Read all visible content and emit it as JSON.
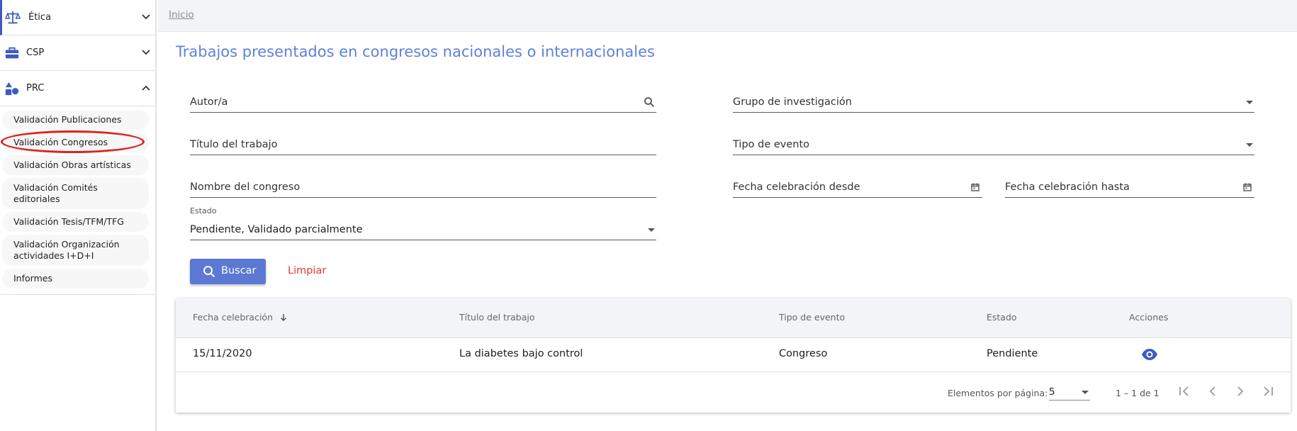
{
  "sidebar": {
    "groups": [
      {
        "label": "Ética",
        "icon": "scales-icon",
        "expanded": false
      },
      {
        "label": "CSP",
        "icon": "briefcase-icon",
        "expanded": false
      },
      {
        "label": "PRC",
        "icon": "shapes-icon",
        "expanded": true
      }
    ],
    "prc_items": [
      "Validación Publicaciones",
      "Validación Congresos",
      "Validación Obras artísticas",
      "Validación Comités editoriales",
      "Validación Tesis/TFM/TFG",
      "Validación Organización actividades I+D+I",
      "Informes"
    ],
    "highlighted_item": "Validación Congresos"
  },
  "breadcrumb": "Inicio",
  "page_title": "Trabajos presentados en congresos nacionales o internacionales",
  "filters": {
    "autor": {
      "label": "Autor/a"
    },
    "grupo": {
      "label": "Grupo de investigación"
    },
    "titulo": {
      "label": "Título del trabajo"
    },
    "tipo_evento": {
      "label": "Tipo de evento"
    },
    "congreso": {
      "label": "Nombre del congreso"
    },
    "fecha_desde": {
      "label": "Fecha celebración desde"
    },
    "fecha_hasta": {
      "label": "Fecha celebración hasta"
    },
    "estado": {
      "label": "Estado",
      "value": "Pendiente, Validado parcialmente"
    }
  },
  "buttons": {
    "search": "Buscar",
    "clear": "Limpiar"
  },
  "table": {
    "headers": [
      "Fecha celebración",
      "Título del trabajo",
      "Tipo de evento",
      "Estado",
      "Acciones"
    ],
    "rows": [
      {
        "fecha": "15/11/2020",
        "titulo": "La diabetes bajo control",
        "tipo": "Congreso",
        "estado": "Pendiente"
      }
    ]
  },
  "paginator": {
    "items_per_page_label": "Elementos por página:",
    "page_size": "5",
    "range": "1 – 1 de 1"
  },
  "colors": {
    "accent": "#5b78d3",
    "title": "#5f81d9",
    "clear": "#e53935",
    "highlight": "#e02020"
  }
}
